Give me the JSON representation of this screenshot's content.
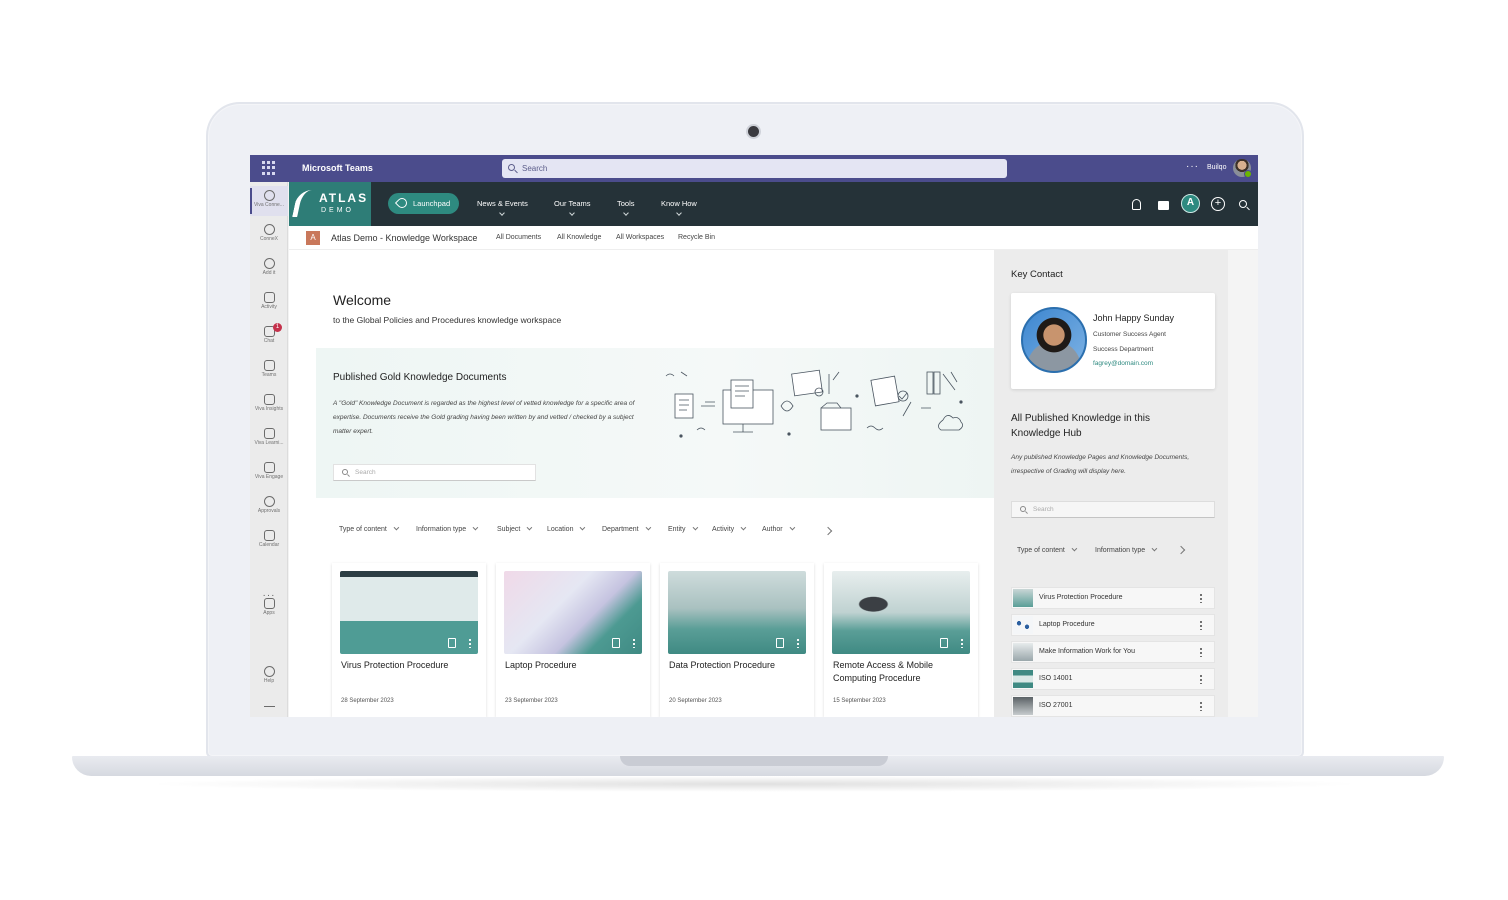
{
  "teams": {
    "app_title": "Microsoft Teams",
    "search_placeholder": "Search",
    "more": "···",
    "user_name": "Builqo"
  },
  "rail": {
    "items": [
      {
        "label": "Viva Conne...",
        "icon": "viva-connections-icon"
      },
      {
        "label": "ConneX",
        "icon": "connex-icon"
      },
      {
        "label": "Add it",
        "icon": "add-icon"
      },
      {
        "label": "Activity",
        "icon": "bell-icon"
      },
      {
        "label": "Chat",
        "icon": "chat-icon",
        "badge": "1"
      },
      {
        "label": "Teams",
        "icon": "teams-icon"
      },
      {
        "label": "Viva Insights",
        "icon": "insights-icon"
      },
      {
        "label": "Viva Learni...",
        "icon": "learning-icon"
      },
      {
        "label": "Viva Engage",
        "icon": "engage-icon"
      },
      {
        "label": "Approvals",
        "icon": "approvals-icon"
      },
      {
        "label": "Calendar",
        "icon": "calendar-icon"
      }
    ],
    "more": "···",
    "apps_label": "Apps",
    "help_label": "Help"
  },
  "atlas": {
    "logo_top": "ATLAS",
    "logo_bottom": "DEMO",
    "launchpad": "Launchpad",
    "nav": [
      "News & Events",
      "Our Teams",
      "Tools",
      "Know How"
    ],
    "avatar_letter": "A",
    "plus_symbol": "+"
  },
  "breadcrumb": {
    "badge": "A",
    "title": "Atlas Demo - Knowledge Workspace",
    "links": [
      "All Documents",
      "All Knowledge",
      "All Workspaces",
      "Recycle Bin"
    ]
  },
  "main": {
    "welcome": "Welcome",
    "welcome_sub": "to the Global Policies and Procedures knowledge workspace",
    "gold_title": "Published Gold Knowledge Documents",
    "gold_desc": "A \"Gold\" Knowledge Document is regarded as the highest level of vetted knowledge for a specific area of expertise. Documents receive the Gold grading having been written by and vetted / checked by a subject matter expert.",
    "search_placeholder": "Search",
    "filters": [
      "Type of content",
      "Information type",
      "Subject",
      "Location",
      "Department",
      "Entity",
      "Activity",
      "Author"
    ],
    "cards": [
      {
        "title": "Virus Protection Procedure",
        "date": "28 September 2023"
      },
      {
        "title": "Laptop Procedure",
        "date": "23 September 2023"
      },
      {
        "title": "Data Protection Procedure",
        "date": "20 September 2023"
      },
      {
        "title": "Remote Access & Mobile Computing Procedure",
        "date": "15 September 2023"
      }
    ]
  },
  "side": {
    "key_contact_title": "Key Contact",
    "contact": {
      "name": "John Happy Sunday",
      "role": "Customer Success Agent",
      "department": "Success Department",
      "email": "fagrey@domain.com"
    },
    "hub_title": "All Published Knowledge in this Knowledge Hub",
    "hub_desc": "Any published Knowledge Pages and Knowledge Documents, irrespective of Grading will display here.",
    "search_placeholder": "Search",
    "filters": [
      "Type of content",
      "Information type"
    ],
    "items": [
      "Virus Protection Procedure",
      "Laptop Procedure",
      "Make Information Work for You",
      "ISO 14001",
      "ISO 27001"
    ]
  },
  "colors": {
    "teams_purple": "#4b4c8c",
    "atlas_dark": "#253238",
    "atlas_teal": "#2e8a80"
  }
}
